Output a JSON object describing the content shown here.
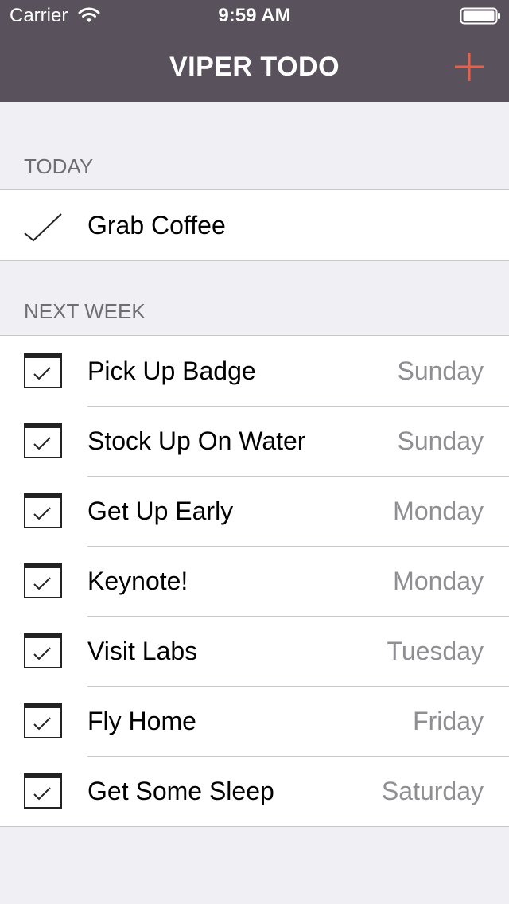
{
  "status_bar": {
    "carrier": "Carrier",
    "time": "9:59 AM",
    "wifi_icon": "wifi-icon",
    "battery_icon": "battery-icon"
  },
  "nav": {
    "title": "VIPER TODO",
    "add_icon": "plus-icon"
  },
  "colors": {
    "nav_background": "#59525c",
    "accent": "#e8604c",
    "background": "#efeff4",
    "separator": "#c8c7cc",
    "secondary_text": "#8e8e93",
    "section_header_text": "#6d6d72"
  },
  "sections": [
    {
      "header": "TODAY",
      "items": [
        {
          "title": "Grab Coffee",
          "day": "",
          "icon": "checkmark-icon"
        }
      ]
    },
    {
      "header": "NEXT WEEK",
      "items": [
        {
          "title": "Pick Up Badge",
          "day": "Sunday",
          "icon": "calendar-check-icon"
        },
        {
          "title": "Stock Up On Water",
          "day": "Sunday",
          "icon": "calendar-check-icon"
        },
        {
          "title": "Get Up Early",
          "day": "Monday",
          "icon": "calendar-check-icon"
        },
        {
          "title": "Keynote!",
          "day": "Monday",
          "icon": "calendar-check-icon"
        },
        {
          "title": "Visit Labs",
          "day": "Tuesday",
          "icon": "calendar-check-icon"
        },
        {
          "title": "Fly Home",
          "day": "Friday",
          "icon": "calendar-check-icon"
        },
        {
          "title": "Get Some Sleep",
          "day": "Saturday",
          "icon": "calendar-check-icon"
        }
      ]
    }
  ]
}
